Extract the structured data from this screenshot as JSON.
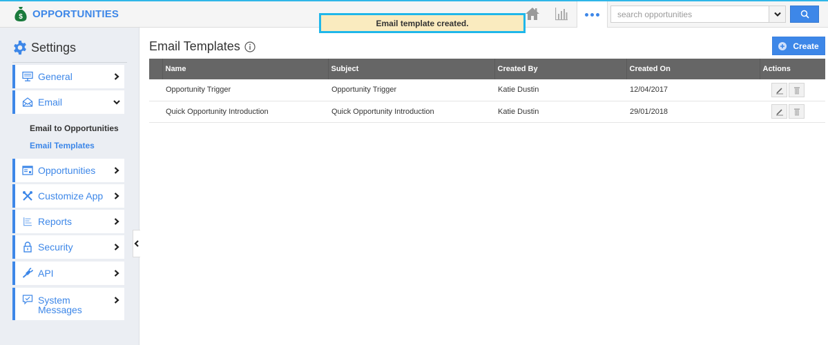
{
  "app": {
    "title": "OPPORTUNITIES",
    "brand_icon": "money-bag-icon",
    "brand_color": "#3d87e8",
    "icon_color": "#1a7a3c"
  },
  "topnav": {
    "items": [
      {
        "name": "home",
        "icon": "home-icon"
      },
      {
        "name": "reports",
        "icon": "bar-chart-icon"
      },
      {
        "name": "more",
        "icon": "more-dots-icon"
      }
    ],
    "search": {
      "value": "",
      "placeholder": "search opportunities"
    }
  },
  "toast": {
    "message": "Email template created.",
    "bg_color": "#faebbf",
    "border_color": "#1fb7ea"
  },
  "sidebar": {
    "title": "Settings",
    "title_icon": "gear-icon",
    "items": [
      {
        "label": "General",
        "icon": "monitor-icon",
        "expanded": false
      },
      {
        "label": "Email",
        "icon": "envelope-icon",
        "expanded": true
      },
      {
        "label": "Opportunities",
        "icon": "opportunity-card-icon",
        "expanded": false
      },
      {
        "label": "Customize App",
        "icon": "tools-icon",
        "expanded": false
      },
      {
        "label": "Reports",
        "icon": "report-list-icon",
        "expanded": false
      },
      {
        "label": "Security",
        "icon": "lock-icon",
        "expanded": false
      },
      {
        "label": "API",
        "icon": "plug-icon",
        "expanded": false
      },
      {
        "label": "System Messages",
        "label_line1": "System",
        "label_line2": "Messages",
        "icon": "message-check-icon",
        "expanded": false
      }
    ],
    "email_subitems": [
      {
        "label": "Email to Opportunities",
        "active": false
      },
      {
        "label": "Email Templates",
        "active": true
      }
    ]
  },
  "main": {
    "title": "Email Templates",
    "create_label": "Create",
    "table": {
      "columns": [
        "",
        "Name",
        "Subject",
        "Created By",
        "Created On",
        "Actions"
      ],
      "rows": [
        {
          "name": "Opportunity Trigger",
          "subject": "Opportunity Trigger",
          "created_by": "Katie Dustin",
          "created_on": "12/04/2017"
        },
        {
          "name": "Quick Opportunity Introduction",
          "subject": "Quick Opportunity Introduction",
          "created_by": "Katie Dustin",
          "created_on": "29/01/2018"
        }
      ],
      "row_actions": [
        "edit",
        "delete"
      ]
    }
  }
}
